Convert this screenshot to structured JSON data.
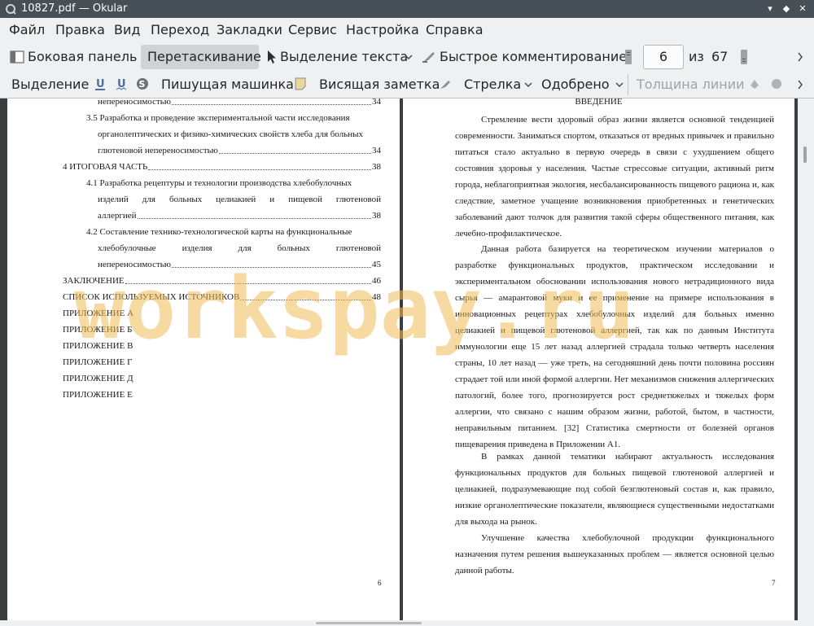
{
  "window": {
    "title": "10827.pdf  — Okular",
    "controls": [
      "▾",
      "◆",
      "✕"
    ]
  },
  "menu": [
    "Файл",
    "Правка",
    "Вид",
    "Переход",
    "Закладки",
    "Сервис",
    "Настройка",
    "Справка"
  ],
  "toolbar1": {
    "sidebar": "Боковая панель",
    "drag": "Перетаскивание",
    "text_select": "Выделение текста",
    "quick_comment": "Быстрое комментирование",
    "page_current": "6",
    "page_of": "из",
    "page_total": "67"
  },
  "toolbar2": {
    "selection": "Выделение",
    "typewriter": "Пишущая машинка",
    "pinned_note": "Висящая заметка",
    "arrow": "Стрелка",
    "approved": "Одобрено",
    "line_width": "Толщина линии"
  },
  "left_page": {
    "entries": [
      {
        "text": "непереносимостью",
        "num": "34"
      },
      {
        "text": "3.5 Разработка и проведение экспериментальной части исследования"
      },
      {
        "text": "органолептических и физико-химических свойств хлеба для больных"
      },
      {
        "text": "глютеновой непереносимостью",
        "num": "34"
      },
      {
        "text": "4 ИТОГОВАЯ ЧАСТЬ",
        "num": "38"
      },
      {
        "text": "4.1 Разработка рецептуры и технологии производства хлебобулочных"
      },
      {
        "text": "изделий для больных целиакией и пищевой глютеновой"
      },
      {
        "text": "аллергией",
        "num": "38"
      },
      {
        "text": "4.2 Составление технико-технологической карты на функциональные"
      },
      {
        "text": "хлебобулочные изделия для больных глютеновой"
      },
      {
        "text": "непереносимостью",
        "num": "45"
      },
      {
        "text": "ЗАКЛЮЧЕНИЕ",
        "num": "46"
      },
      {
        "text": "СПИСОК ИСПОЛЬЗУЕМЫХ ИСТОЧНИКОВ",
        "num": "48"
      },
      {
        "text": "ПРИЛОЖЕНИЕ А"
      },
      {
        "text": "ПРИЛОЖЕНИЕ Б"
      },
      {
        "text": "ПРИЛОЖЕНИЕ В"
      },
      {
        "text": "ПРИЛОЖЕНИЕ Г"
      },
      {
        "text": "ПРИЛОЖЕНИЕ Д"
      },
      {
        "text": "ПРИЛОЖЕНИЕ Е"
      }
    ],
    "page_number": "6"
  },
  "right_page": {
    "heading": "ВВЕДЕНИЕ",
    "paragraphs": [
      "Стремление вести здоровый образ жизни является основной тенденцией современности. Заниматься спортом, отказаться от вредных привычек и правильно питаться стало актуально в первую очередь в связи с ухудшением общего состояния здоровья у населения. Частые стрессовые ситуации, активный ритм города, неблагоприятная экология, несбалансированность пищевого рациона и, как следствие, заметное учащение возникновения приобретенных и генетических заболеваний дают толчок для развития такой сферы общественного питания, как лечебно-профилактическое.",
      "Данная работа базируется на теоретическом изучении материалов о разработке функциональных продуктов, практическом исследовании и экспериментальном обосновании использования нового нетрадиционного вида сырья — амарантовой муки и ее применение на примере использования в инновационных рецептурах хлебобулочных изделий для больных именно целиакией и пищевой глютеновой аллергией, так как по данным Института иммунологии еще 15 лет назад аллергией страдала только четверть населения страны, 10 лет назад — уже треть, на сегодняшний день почти половина россиян страдает той или иной формой аллергии. Нет механизмов снижения аллергических патологий, более того, прогнозируется рост среднетяжелых и тяжелых форм аллергии, что связано с нашим образом жизни, работой, бытом, в частности, неправильным питанием. [32] Статистика смертности от болезней органов пищеварения приведена в Приложении А1.",
      "В рамках данной тематики набирают актуальность исследования функциональных продуктов для больных пищевой глютеновой аллергией и целиакией, подразумевающие под собой безглютеновый состав и, как правило, низкие органолептические показатели, являющиеся существенными недостатками для выхода на рынок.",
      "Улучшение качества хлебобулочной продукции функционального назначения путем решения вышеуказанных проблем — является основной целью данной работы."
    ],
    "page_number": "7"
  },
  "watermark": "workspay.ru"
}
